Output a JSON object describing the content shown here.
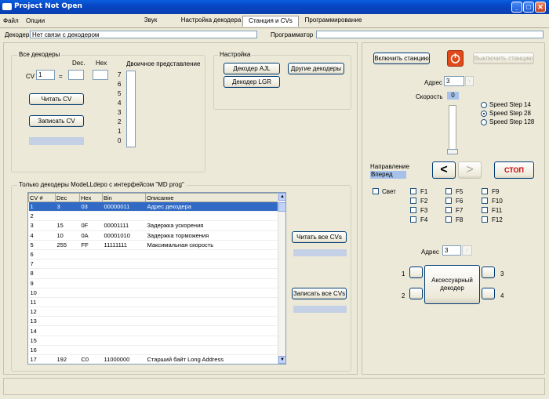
{
  "window": {
    "title": "Project  Not Open",
    "min": "_",
    "max": "□",
    "close": "✕"
  },
  "menu": [
    "Файл",
    "Опции"
  ],
  "tabs": [
    "Звук",
    "Настройка декодера",
    "Станция и CVs",
    "Программирование"
  ],
  "status": {
    "decoder_label": "Декодер",
    "decoder_value": "Нет связи с декодером",
    "programmer_label": "Программатор",
    "programmer_value": ""
  },
  "all_decoders": {
    "title": "Все декодеры",
    "cv_label": "CV",
    "cv_value": "1",
    "eq": "=",
    "dec_label": "Dec.",
    "hex_label": "Hex",
    "bin_label": "Двоичное представление",
    "bits": [
      "7",
      "6",
      "5",
      "4",
      "3",
      "2",
      "1",
      "0"
    ],
    "read_btn": "Читать CV",
    "write_btn": "Записать CV"
  },
  "settings": {
    "title": "Настройка",
    "ajl": "Декодер AJL",
    "lgr": "Декодер LGR",
    "other": "Другие декодеры"
  },
  "modelldepo": {
    "title": "Только декодеры ModeLLdepo с интерфейсом \"MD prog\"",
    "columns": [
      "CV #",
      "Dec",
      "Hex",
      "Bin",
      "Описание"
    ],
    "rows": [
      [
        "1",
        "3",
        "03",
        "00000011",
        "Адрес декодера"
      ],
      [
        "2",
        "",
        "",
        "",
        ""
      ],
      [
        "3",
        "15",
        "0F",
        "00001111",
        "Задержка ускорения"
      ],
      [
        "4",
        "10",
        "0A",
        "00001010",
        "Задержка торможения"
      ],
      [
        "5",
        "255",
        "FF",
        "11111111",
        "Максимальная скорость"
      ],
      [
        "6",
        "",
        "",
        "",
        ""
      ],
      [
        "7",
        "",
        "",
        "",
        ""
      ],
      [
        "8",
        "",
        "",
        "",
        ""
      ],
      [
        "9",
        "",
        "",
        "",
        ""
      ],
      [
        "10",
        "",
        "",
        "",
        ""
      ],
      [
        "11",
        "",
        "",
        "",
        ""
      ],
      [
        "12",
        "",
        "",
        "",
        ""
      ],
      [
        "13",
        "",
        "",
        "",
        ""
      ],
      [
        "14",
        "",
        "",
        "",
        ""
      ],
      [
        "15",
        "",
        "",
        "",
        ""
      ],
      [
        "16",
        "",
        "",
        "",
        ""
      ],
      [
        "17",
        "192",
        "C0",
        "11000000",
        "Старший байт Long Address"
      ]
    ],
    "read_all": "Читать все CVs",
    "write_all": "Записать все CVs"
  },
  "station": {
    "on_btn": "Включить станцию",
    "off_btn": "Выключить станцию",
    "addr_label": "Адрес",
    "addr_value": "3",
    "speed_label": "Скорость",
    "speed_value": "0",
    "speed_steps": [
      "Speed Step 14",
      "Speed Step 28",
      "Speed Step 128"
    ],
    "selected_step": 1,
    "direction_label": "Направление",
    "direction_value": "Вперед",
    "back": "<",
    "fwd": ">",
    "stop": "СТОП",
    "light": "Свет",
    "functions": [
      "F1",
      "F2",
      "F3",
      "F4",
      "F5",
      "F6",
      "F7",
      "F8",
      "F9",
      "F10",
      "F11",
      "F12"
    ]
  },
  "accessory": {
    "addr_label": "Адрес",
    "addr_value": "3",
    "label": "Аксессуарный декодер",
    "ports": [
      "1",
      "2",
      "3",
      "4"
    ]
  },
  "colors": {
    "titlebar": "#0a5fe0",
    "selection": "#316ac5",
    "stop_red": "#cc0000",
    "power_icon": "#e04a1a"
  }
}
